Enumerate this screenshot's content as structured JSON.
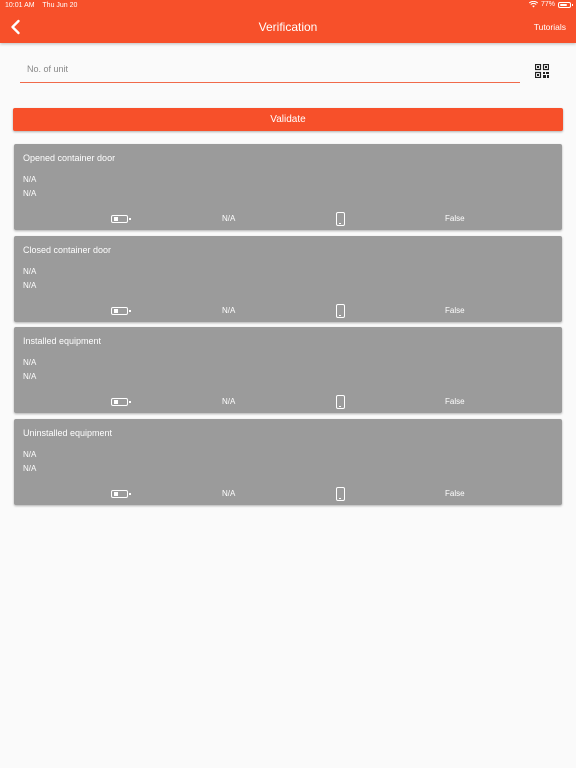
{
  "status_bar": {
    "time": "10:01 AM",
    "date": "Thu Jun 20",
    "battery_percent": "77%",
    "battery_level": 0.77
  },
  "header": {
    "title": "Verification",
    "tutorials_label": "Tutorials"
  },
  "unit_input": {
    "placeholder": "No. of unit",
    "value": ""
  },
  "validate_label": "Validate",
  "cards": [
    {
      "title": "Opened container door",
      "line1": "N/A",
      "line2": "N/A",
      "battery": "N/A",
      "device": "False"
    },
    {
      "title": "Closed container door",
      "line1": "N/A",
      "line2": "N/A",
      "battery": "N/A",
      "device": "False"
    },
    {
      "title": "Installed equipment",
      "line1": "N/A",
      "line2": "N/A",
      "battery": "N/A",
      "device": "False"
    },
    {
      "title": "Uninstalled equipment",
      "line1": "N/A",
      "line2": "N/A",
      "battery": "N/A",
      "device": "False"
    }
  ],
  "colors": {
    "accent": "#f7502a",
    "card": "#9b9b9b",
    "background": "#fafafa"
  }
}
